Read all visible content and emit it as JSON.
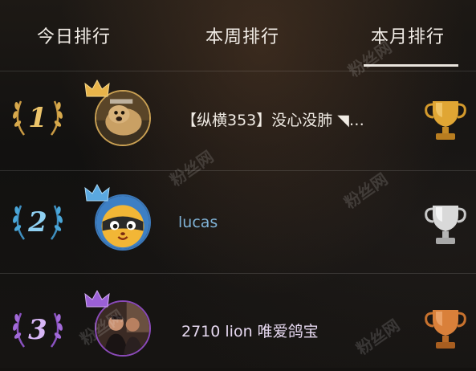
{
  "tabs": {
    "today": "今日排行",
    "week": "本周排行",
    "month": "本月排行",
    "active": "month"
  },
  "watermark": "粉丝网",
  "ranking": [
    {
      "rank": "1",
      "name": "【纵横353】没心没肺 ◥…",
      "medal_color": "#d8a84a",
      "trophy": "gold-trophy-icon",
      "name_color": "#f0ebe4"
    },
    {
      "rank": "2",
      "name": "lucas",
      "medal_color": "#4aa6d8",
      "trophy": "silver-trophy-icon",
      "name_color": "#7fb2d6"
    },
    {
      "rank": "3",
      "name": "2710 lion 唯爱鸽宝",
      "medal_color": "#a26ad8",
      "trophy": "bronze-trophy-icon",
      "name_color": "#e6d8f0"
    }
  ]
}
